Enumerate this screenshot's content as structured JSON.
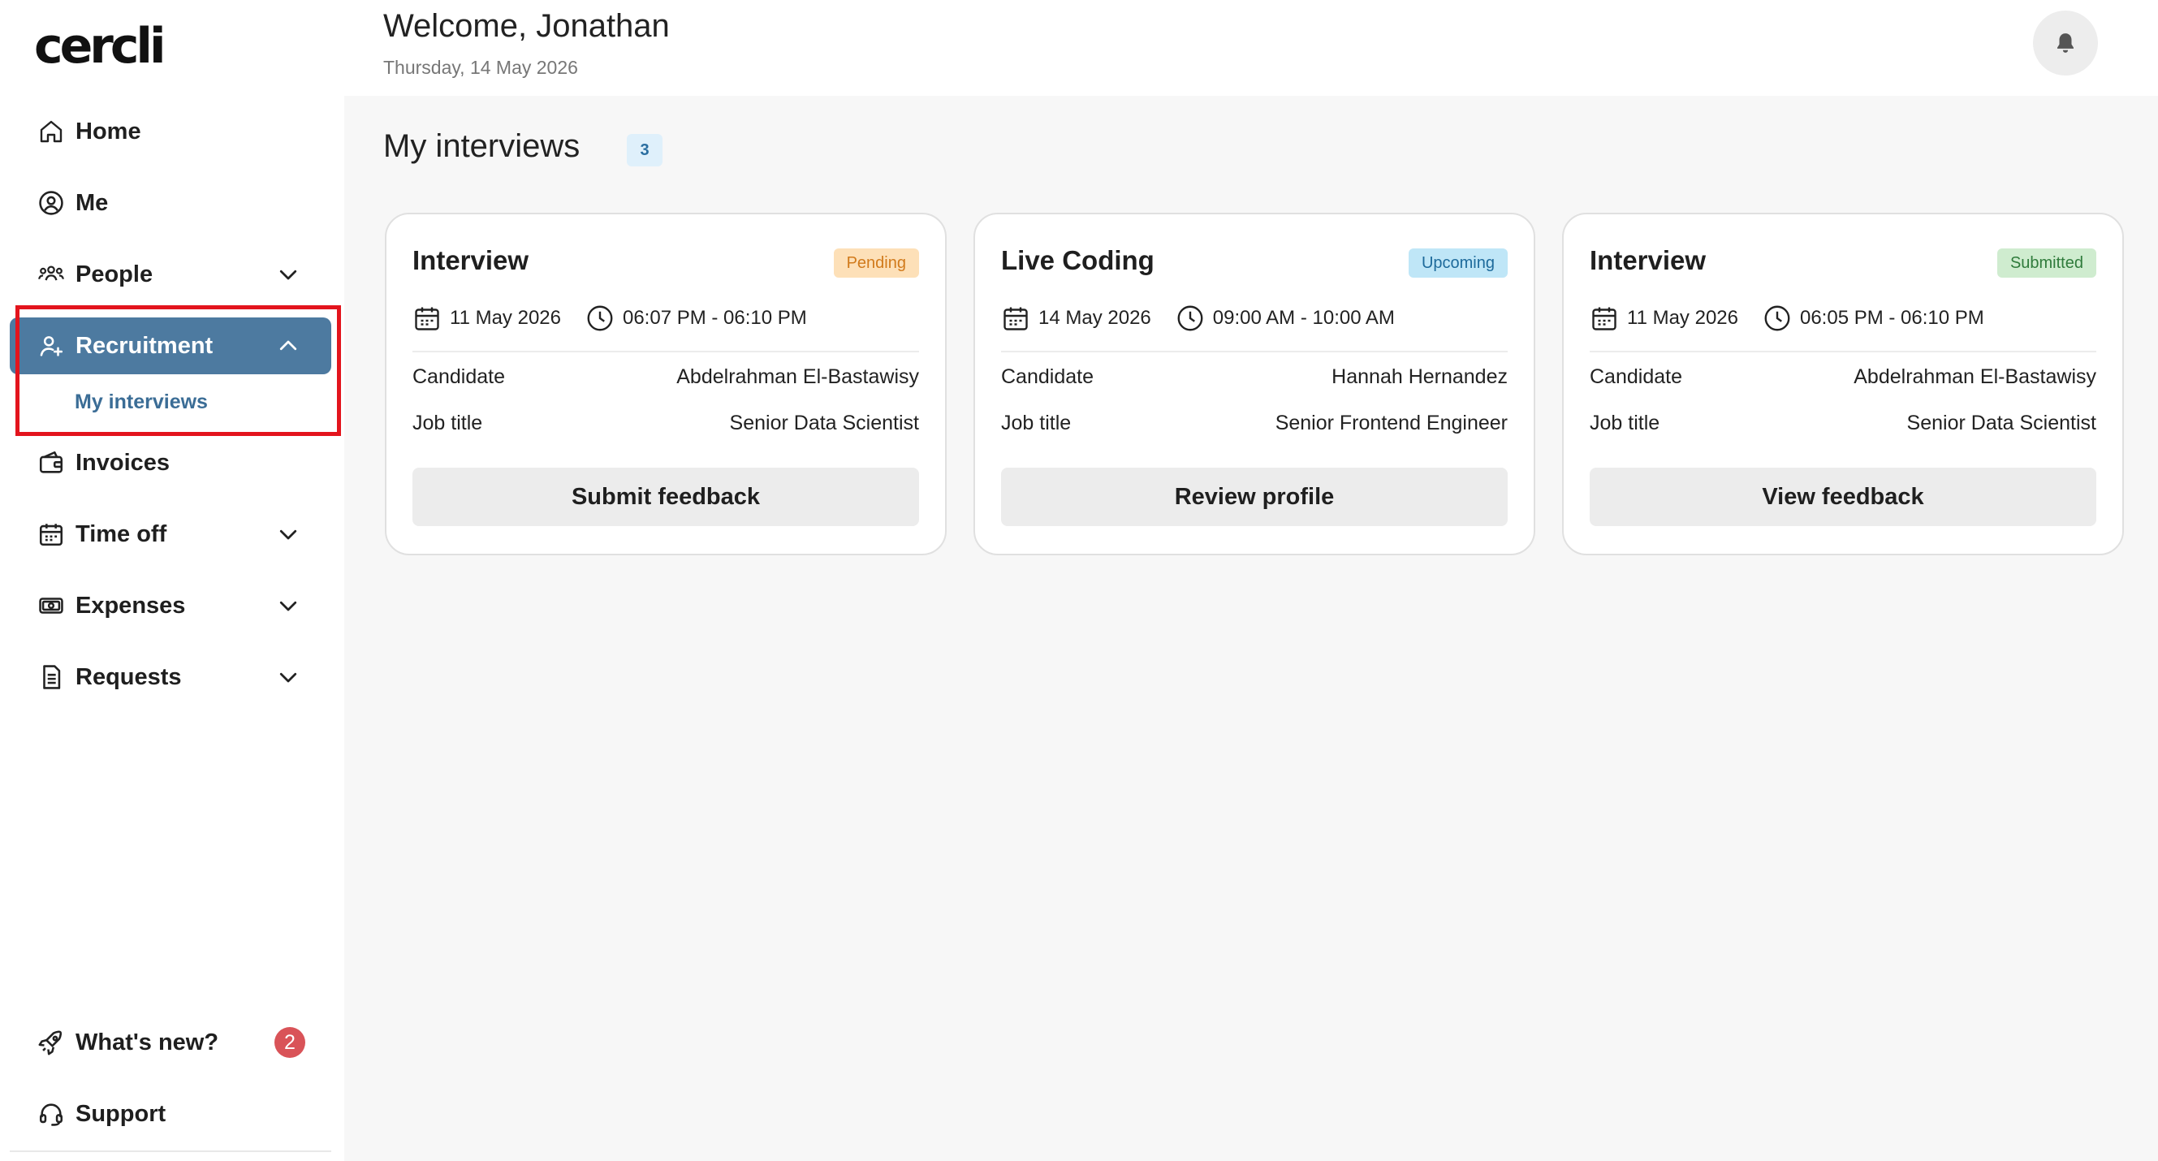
{
  "app": {
    "logo_text": "cercli"
  },
  "sidebar": {
    "items": [
      {
        "label": "Home",
        "icon": "home-icon"
      },
      {
        "label": "Me",
        "icon": "user-circle-icon"
      },
      {
        "label": "People",
        "icon": "people-icon"
      },
      {
        "label": "Recruitment",
        "icon": "user-plus-icon"
      },
      {
        "label": "Invoices",
        "icon": "wallet-icon"
      },
      {
        "label": "Time off",
        "icon": "calendar-icon"
      },
      {
        "label": "Expenses",
        "icon": "cash-icon"
      },
      {
        "label": "Requests",
        "icon": "document-icon"
      }
    ],
    "sub_item_label": "My interviews",
    "whats_new_label": "What's new?",
    "whats_new_count": "2",
    "support_label": "Support",
    "active_color": "#4d7aa0"
  },
  "header": {
    "welcome": "Welcome, Jonathan",
    "date": "Thursday, 14 May 2026",
    "bell_icon": "bell-icon"
  },
  "main": {
    "title": "My interviews",
    "count": "3",
    "labels": {
      "candidate": "Candidate",
      "job_title": "Job title"
    },
    "cards": [
      {
        "title": "Interview",
        "status": "Pending",
        "status_color": "#d17a1b",
        "date": "11 May 2026",
        "time": "06:07 PM - 06:10 PM",
        "candidate": "Abdelrahman El-Bastawisy",
        "job_title": "Senior Data Scientist",
        "action": "Submit feedback"
      },
      {
        "title": "Live Coding",
        "status": "Upcoming",
        "status_color": "#1d6a9b",
        "date": "14 May 2026",
        "time": "09:00 AM - 10:00 AM",
        "candidate": "Hannah Hernandez",
        "job_title": "Senior Frontend Engineer",
        "action": "Review profile"
      },
      {
        "title": "Interview",
        "status": "Submitted",
        "status_color": "#2f7b3b",
        "date": "11 May 2026",
        "time": "06:05 PM - 06:10 PM",
        "candidate": "Abdelrahman El-Bastawisy",
        "job_title": "Senior Data Scientist",
        "action": "View feedback"
      }
    ]
  }
}
